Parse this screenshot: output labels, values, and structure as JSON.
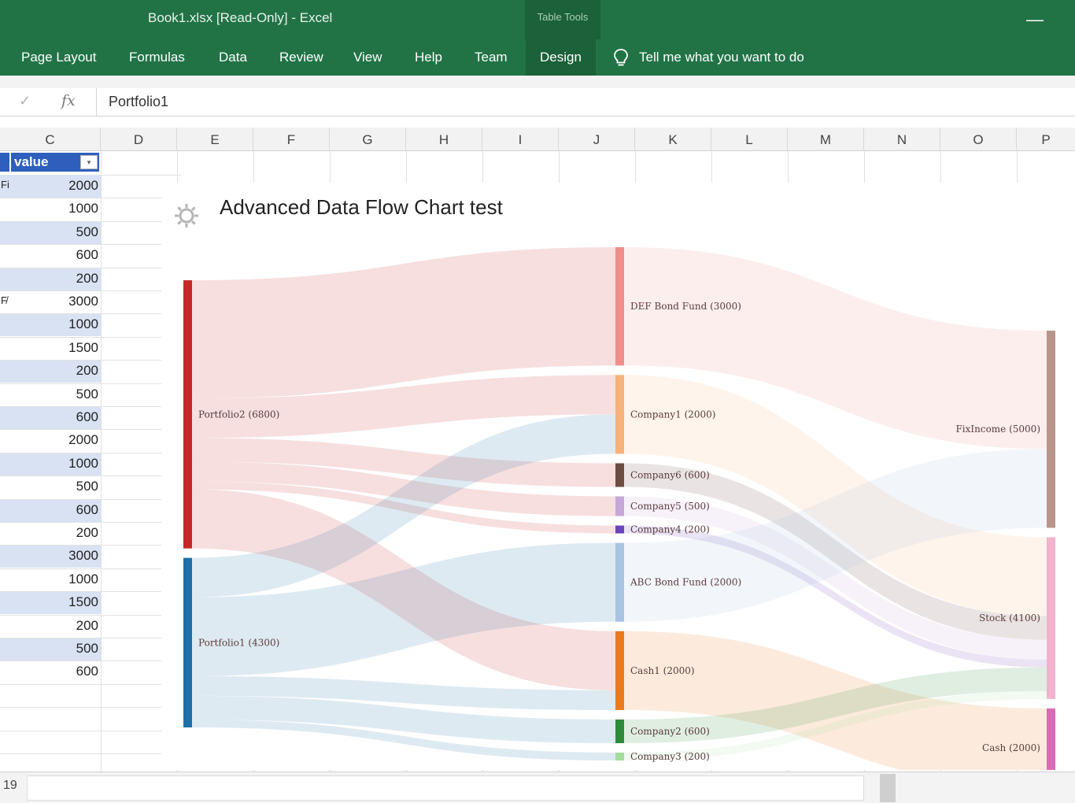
{
  "window": {
    "doc_title": "Book1.xlsx  [Read-Only]  -  Excel",
    "context_tab": "Table Tools",
    "minimize_glyph": "—"
  },
  "ribbon": {
    "tabs": [
      "Page Layout",
      "Formulas",
      "Data",
      "Review",
      "View",
      "Help",
      "Team"
    ],
    "active_tab": "Design",
    "tell_me": "Tell me what you want to do"
  },
  "formula_bar": {
    "check_glyph": "✓",
    "fx_label": "fx",
    "value": "Portfolio1"
  },
  "columns": [
    "C",
    "D",
    "E",
    "F",
    "G",
    "H",
    "I",
    "J",
    "K",
    "L",
    "M",
    "N",
    "O",
    "P"
  ],
  "table": {
    "header": "value",
    "filter_glyph": "▾",
    "values": [
      "2000",
      "1000",
      "500",
      "600",
      "200",
      "3000",
      "1000",
      "1500",
      "200",
      "500",
      "600",
      "2000",
      "1000",
      "500",
      "600",
      "200",
      "3000",
      "1000",
      "1500",
      "200",
      "500",
      "600"
    ],
    "fragments": [
      {
        "row": 0,
        "text": "Fi"
      },
      {
        "row": 5,
        "text": "F̸"
      }
    ]
  },
  "chart_data": {
    "type": "sankey",
    "title": "Advanced Data Flow Chart test",
    "nodes": [
      {
        "id": "P2",
        "label": "Portfolio2 (6800)",
        "color": "#c62828"
      },
      {
        "id": "P1",
        "label": "Portfolio1 (4300)",
        "color": "#1f6fa8"
      },
      {
        "id": "DEF",
        "label": "DEF Bond Fund (3000)",
        "color": "#ef8f8c"
      },
      {
        "id": "C1",
        "label": "Company1 (2000)",
        "color": "#f6b27a"
      },
      {
        "id": "C6",
        "label": "Company6 (600)",
        "color": "#6d4c41"
      },
      {
        "id": "C5",
        "label": "Company5 (500)",
        "color": "#c6a8d8"
      },
      {
        "id": "C4",
        "label": "Company4 (200)",
        "color": "#6b46b8"
      },
      {
        "id": "ABC",
        "label": "ABC Bond Fund (2000)",
        "color": "#a9c3e3"
      },
      {
        "id": "CASH1",
        "label": "Cash1 (2000)",
        "color": "#ea7a1e"
      },
      {
        "id": "C2",
        "label": "Company2 (600)",
        "color": "#2e8b3c"
      },
      {
        "id": "C3",
        "label": "Company3 (200)",
        "color": "#a5dca0"
      },
      {
        "id": "FI",
        "label": "FixIncome (5000)",
        "color": "#b8958a"
      },
      {
        "id": "STOCK",
        "label": "Stock (4100)",
        "color": "#f3b2cd"
      },
      {
        "id": "CASH",
        "label": "Cash (2000)",
        "color": "#d86cb4"
      }
    ],
    "links": [
      {
        "source": "P2",
        "target": "DEF",
        "value": 3000
      },
      {
        "source": "P2",
        "target": "C1",
        "value": 1000
      },
      {
        "source": "P2",
        "target": "C6",
        "value": 600
      },
      {
        "source": "P2",
        "target": "C5",
        "value": 500
      },
      {
        "source": "P2",
        "target": "C4",
        "value": 200
      },
      {
        "source": "P2",
        "target": "CASH1",
        "value": 1500
      },
      {
        "source": "P1",
        "target": "C1",
        "value": 1000
      },
      {
        "source": "P1",
        "target": "ABC",
        "value": 2000
      },
      {
        "source": "P1",
        "target": "CASH1",
        "value": 500
      },
      {
        "source": "P1",
        "target": "C2",
        "value": 600
      },
      {
        "source": "P1",
        "target": "C3",
        "value": 200
      },
      {
        "source": "DEF",
        "target": "FI",
        "value": 3000
      },
      {
        "source": "C1",
        "target": "STOCK",
        "value": 2000
      },
      {
        "source": "C6",
        "target": "STOCK",
        "value": 600
      },
      {
        "source": "C5",
        "target": "STOCK",
        "value": 500
      },
      {
        "source": "C4",
        "target": "STOCK",
        "value": 200
      },
      {
        "source": "ABC",
        "target": "FI",
        "value": 2000
      },
      {
        "source": "CASH1",
        "target": "CASH",
        "value": 2000
      },
      {
        "source": "C2",
        "target": "STOCK",
        "value": 600
      },
      {
        "source": "C3",
        "target": "STOCK",
        "value": 200
      }
    ]
  },
  "status_bar": {
    "row_number": "19"
  },
  "colors": {
    "excel_green": "#217346",
    "table_header": "#2e5fbd",
    "table_band": "#d9e2f3"
  }
}
